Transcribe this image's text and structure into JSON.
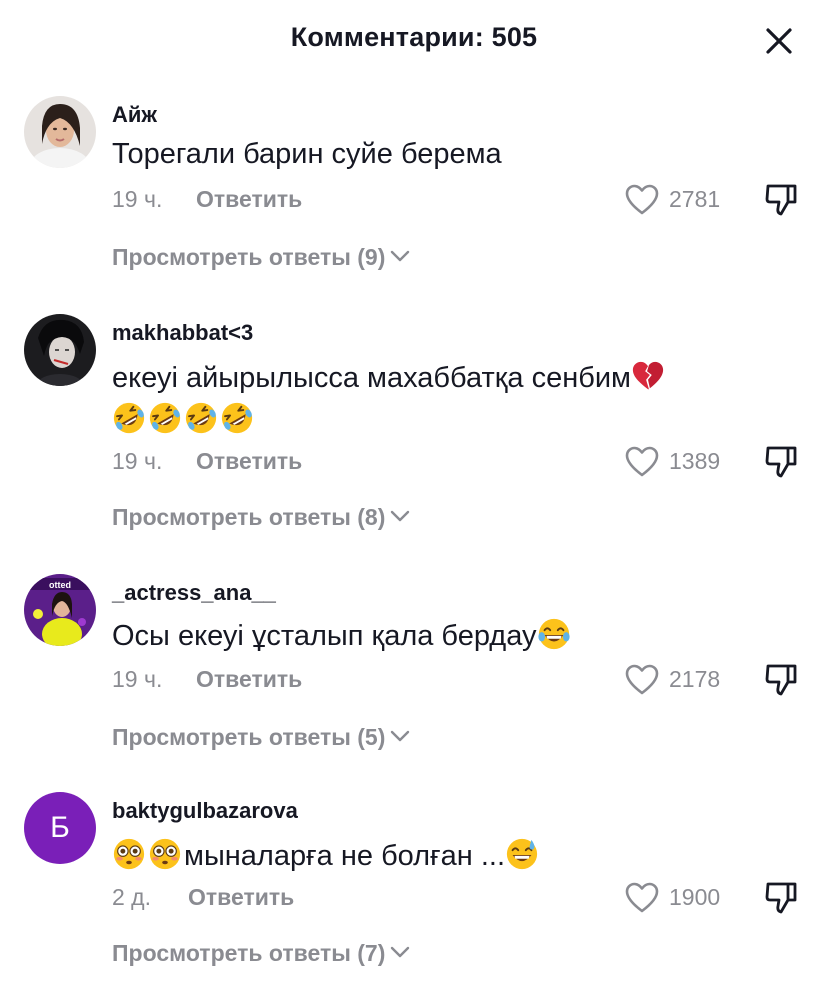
{
  "header": {
    "title": "Комментарии: 505"
  },
  "reply_label": "Ответить",
  "comments": [
    {
      "username": "Айж",
      "text": "Торегали барин суйе берема",
      "time": "19 ч.",
      "likes": "2781",
      "view_replies": "Просмотреть ответы (9)"
    },
    {
      "username": "makhabbat<3",
      "text": "екеуі айырылысса махаббатқа сенбим",
      "emoji_after_text": [
        "broken-heart"
      ],
      "emoji_line": [
        "rolling-laughing",
        "rolling-laughing",
        "rolling-laughing",
        "rolling-laughing"
      ],
      "time": "19 ч.",
      "likes": "1389",
      "view_replies": "Просмотреть ответы (8)"
    },
    {
      "username": "_actress_ana__",
      "text": "Осы екеуі ұсталып қала бердау",
      "emoji_after_text": [
        "tears-of-joy"
      ],
      "time": "19 ч.",
      "likes": "2178",
      "view_replies": "Просмотреть ответы (5)"
    },
    {
      "username": "baktygulbazarova",
      "avatar_letter": "Б",
      "emoji_before_text": [
        "flushed",
        "flushed"
      ],
      "text": "мыналарға не болған ...",
      "emoji_after_text": [
        "grinning-sweat"
      ],
      "time": "2 д.",
      "likes": "1900",
      "view_replies": "Просмотреть ответы (7)"
    }
  ],
  "icons": {
    "close": "close-icon",
    "like": "heart-outline-icon",
    "dislike": "thumbs-down-icon",
    "chevron": "chevron-down-icon"
  },
  "colors": {
    "text": "#161823",
    "muted": "#8a8b91",
    "avatar_letter_bg": "#7A1FB8"
  }
}
